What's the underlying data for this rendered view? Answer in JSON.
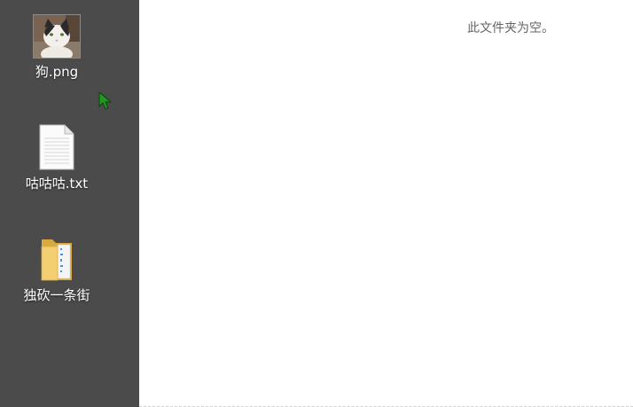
{
  "desktop": {
    "items": [
      {
        "label": "狗.png",
        "icon": "image-thumbnail-icon"
      },
      {
        "label": "咕咕咕.txt",
        "icon": "text-file-icon"
      },
      {
        "label": "独砍一条街",
        "icon": "folder-icon"
      }
    ]
  },
  "folder_view": {
    "empty_message": "此文件夹为空。"
  },
  "cursor": {
    "icon": "mouse-cursor-icon",
    "color": "#1f9a1f"
  },
  "colors": {
    "desktop_bg": "#4b4b4b",
    "pane_bg": "#ffffff",
    "label_text": "#ffffff",
    "empty_text": "#666666"
  }
}
